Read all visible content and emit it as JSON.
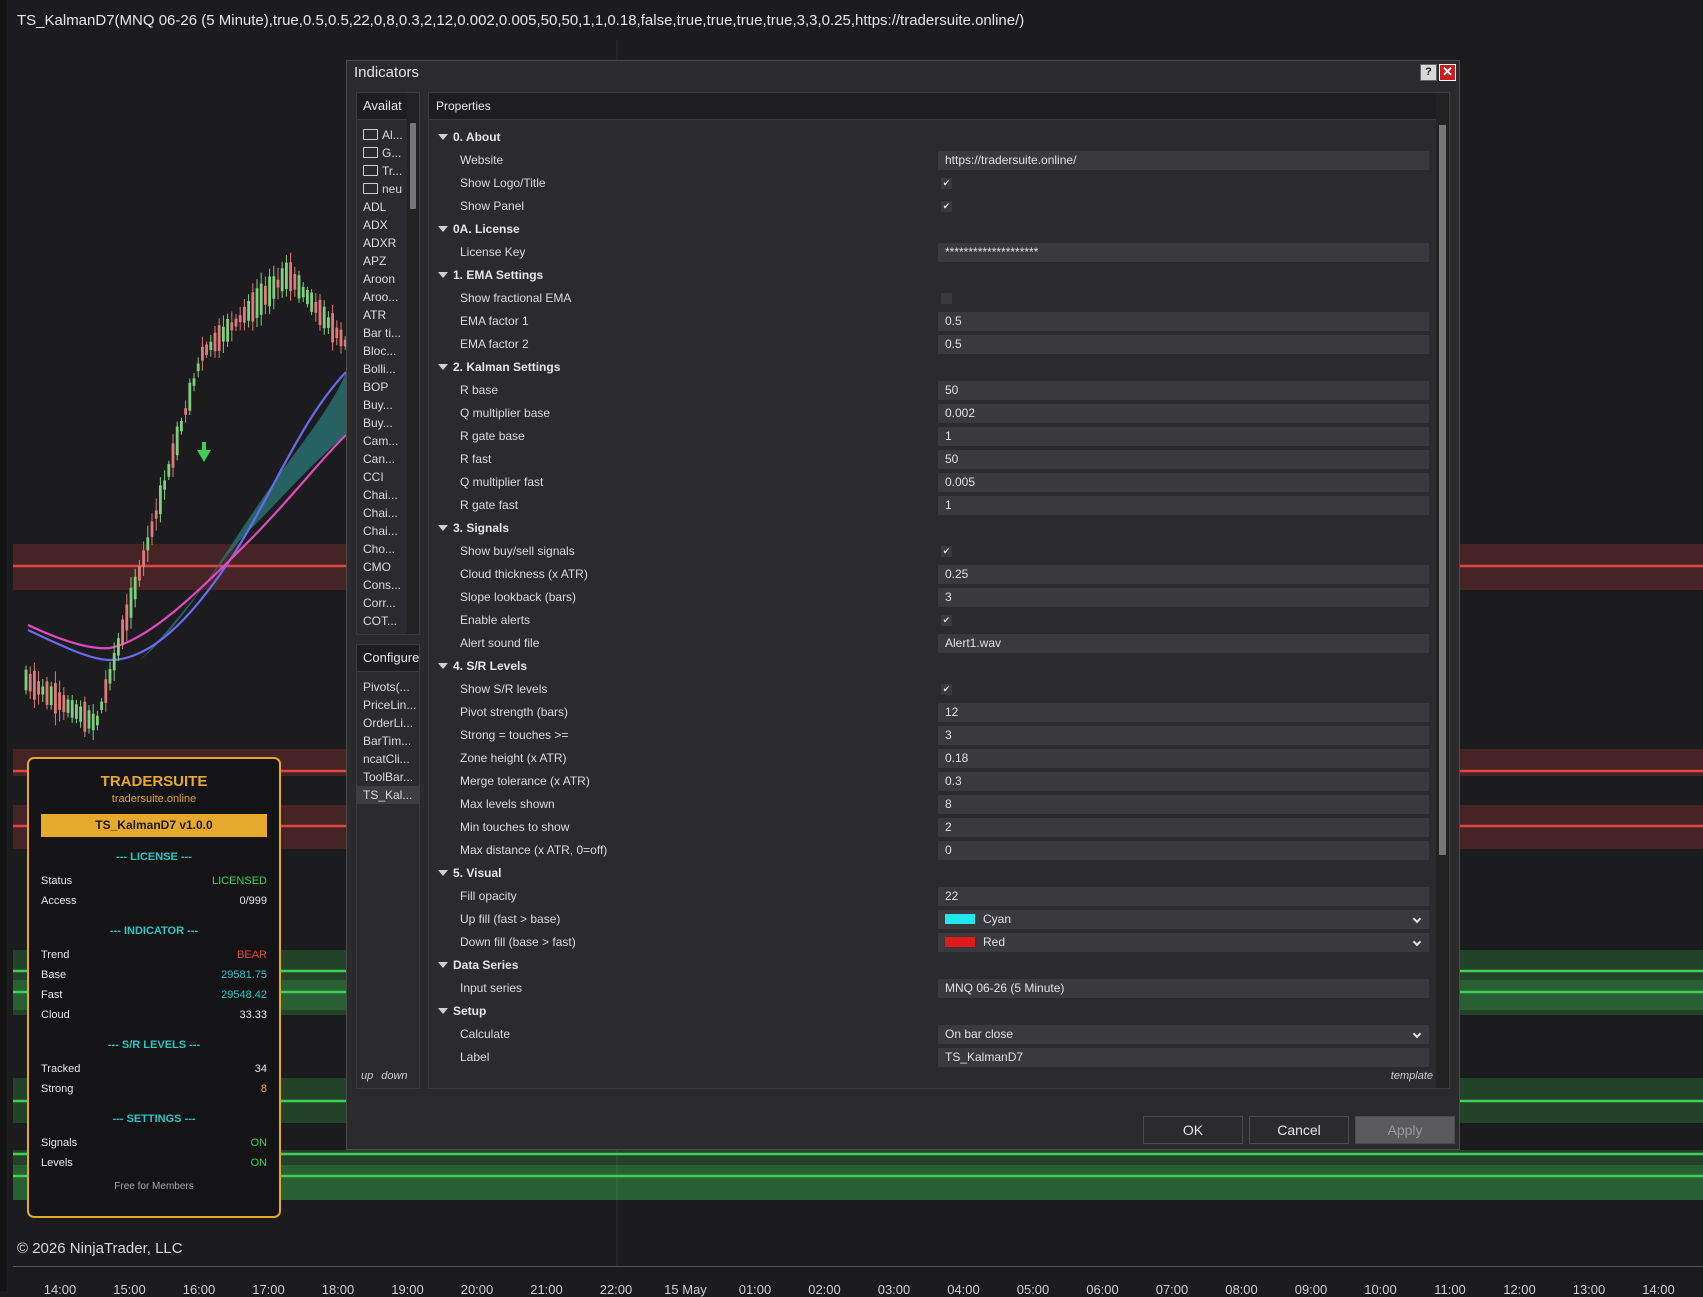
{
  "chart": {
    "title": "TS_KalmanD7(MNQ 06-26 (5 Minute),true,0.5,0.5,22,0,8,0.3,2,12,0.002,0.005,50,50,1,1,0.18,false,true,true,true,true,3,3,0.25,https://tradersuite.online/)",
    "copyright": "© 2026 NinjaTrader, LLC",
    "time_ticks": [
      "14:00",
      "15:00",
      "16:00",
      "17:00",
      "18:00",
      "19:00",
      "20:00",
      "21:00",
      "22:00",
      "15 May",
      "01:00",
      "02:00",
      "03:00",
      "04:00",
      "05:00",
      "06:00",
      "07:00",
      "08:00",
      "09:00",
      "10:00",
      "11:00",
      "12:00",
      "13:00",
      "14:00"
    ],
    "colors": {
      "fast_line": "#e04ac0",
      "base_line": "#6a6af0",
      "cloud_up": "#2a7a7a",
      "resistance": "#e04545",
      "support": "#3ecf55",
      "candle_up": "#7fcf7f",
      "candle_down": "#e07a7a",
      "buy_signal": "#3ecf55"
    }
  },
  "ts_panel": {
    "brand": "TRADERSUITE",
    "site": "tradersuite.online",
    "version": "TS_KalmanD7 v1.0.0",
    "license_title": "--- LICENSE ---",
    "license": [
      {
        "label": "Status",
        "value": "LICENSED",
        "color": "#3ecf55"
      },
      {
        "label": "Access",
        "value": "0/999",
        "color": "#e8e8e8"
      }
    ],
    "indicator_title": "--- INDICATOR ---",
    "indicator": [
      {
        "label": "Trend",
        "value": "BEAR",
        "color": "#e04545"
      },
      {
        "label": "Base",
        "value": "29581.75",
        "color": "#2ec4c4"
      },
      {
        "label": "Fast",
        "value": "29548.42",
        "color": "#2ec4c4"
      },
      {
        "label": "Cloud",
        "value": "33.33",
        "color": "#e8e8e8"
      }
    ],
    "sr_title": "--- S/R LEVELS ---",
    "sr": [
      {
        "label": "Tracked",
        "value": "34",
        "color": "#e8e8e8"
      },
      {
        "label": "Strong",
        "value": "8",
        "color": "#e6a92e"
      }
    ],
    "settings_title": "--- SETTINGS ---",
    "settings": [
      {
        "label": "Signals",
        "value": "ON",
        "color": "#3ecf55"
      },
      {
        "label": "Levels",
        "value": "ON",
        "color": "#3ecf55"
      }
    ],
    "footer": "Free for Members"
  },
  "dialog": {
    "title": "Indicators",
    "help": "?",
    "close": "✕",
    "available_header": "Availat",
    "available_items": [
      {
        "label": "Al...",
        "folder": true
      },
      {
        "label": "G...",
        "folder": true
      },
      {
        "label": "Tr...",
        "folder": true
      },
      {
        "label": "neu",
        "folder": true
      },
      {
        "label": "ADL"
      },
      {
        "label": "ADX"
      },
      {
        "label": "ADXR"
      },
      {
        "label": "APZ"
      },
      {
        "label": "Aroon"
      },
      {
        "label": "Aroo..."
      },
      {
        "label": "ATR"
      },
      {
        "label": "Bar ti..."
      },
      {
        "label": "Bloc..."
      },
      {
        "label": "Bolli..."
      },
      {
        "label": "BOP"
      },
      {
        "label": "Buy..."
      },
      {
        "label": "Buy..."
      },
      {
        "label": "Cam..."
      },
      {
        "label": "Can..."
      },
      {
        "label": "CCI"
      },
      {
        "label": "Chai..."
      },
      {
        "label": "Chai..."
      },
      {
        "label": "Chai..."
      },
      {
        "label": "Cho..."
      },
      {
        "label": "CMO"
      },
      {
        "label": "Cons..."
      },
      {
        "label": "Corr..."
      },
      {
        "label": "COT..."
      }
    ],
    "configured_header": "Configure",
    "configured_items": [
      "Pivots(...",
      "PriceLin...",
      "OrderLi...",
      "BarTim...",
      "ncatCli...",
      "ToolBar...",
      "TS_Kal..."
    ],
    "up_label": "up",
    "down_label": "down",
    "properties_header": "Properties",
    "template_label": "template",
    "properties": [
      {
        "type": "cat",
        "label": "0. About"
      },
      {
        "type": "text",
        "label": "Website",
        "value": "https://tradersuite.online/"
      },
      {
        "type": "check",
        "label": "Show Logo/Title",
        "checked": true
      },
      {
        "type": "check",
        "label": "Show Panel",
        "checked": true
      },
      {
        "type": "cat",
        "label": "0A. License"
      },
      {
        "type": "text",
        "label": "License Key",
        "value": "********************"
      },
      {
        "type": "cat",
        "label": "1. EMA Settings"
      },
      {
        "type": "check",
        "label": "Show fractional EMA",
        "checked": false
      },
      {
        "type": "text",
        "label": "EMA factor 1",
        "value": "0.5"
      },
      {
        "type": "text",
        "label": "EMA factor 2",
        "value": "0.5"
      },
      {
        "type": "cat",
        "label": "2. Kalman Settings"
      },
      {
        "type": "text",
        "label": "R base",
        "value": "50"
      },
      {
        "type": "text",
        "label": "Q multiplier base",
        "value": "0.002"
      },
      {
        "type": "text",
        "label": "R gate base",
        "value": "1"
      },
      {
        "type": "text",
        "label": "R fast",
        "value": "50"
      },
      {
        "type": "text",
        "label": "Q multiplier fast",
        "value": "0.005"
      },
      {
        "type": "text",
        "label": "R gate fast",
        "value": "1"
      },
      {
        "type": "cat",
        "label": "3. Signals"
      },
      {
        "type": "check",
        "label": "Show buy/sell signals",
        "checked": true
      },
      {
        "type": "text",
        "label": "Cloud thickness (x ATR)",
        "value": "0.25"
      },
      {
        "type": "text",
        "label": "Slope lookback (bars)",
        "value": "3"
      },
      {
        "type": "check",
        "label": "Enable alerts",
        "checked": true
      },
      {
        "type": "text",
        "label": "Alert sound file",
        "value": "Alert1.wav"
      },
      {
        "type": "cat",
        "label": "4. S/R Levels"
      },
      {
        "type": "check",
        "label": "Show S/R levels",
        "checked": true
      },
      {
        "type": "text",
        "label": "Pivot strength (bars)",
        "value": "12"
      },
      {
        "type": "text",
        "label": "Strong = touches >=",
        "value": "3"
      },
      {
        "type": "text",
        "label": "Zone height (x ATR)",
        "value": "0.18"
      },
      {
        "type": "text",
        "label": "Merge tolerance (x ATR)",
        "value": "0.3"
      },
      {
        "type": "text",
        "label": "Max levels shown",
        "value": "8"
      },
      {
        "type": "text",
        "label": "Min touches to show",
        "value": "2"
      },
      {
        "type": "text",
        "label": "Max distance (x ATR, 0=off)",
        "value": "0"
      },
      {
        "type": "cat",
        "label": "5. Visual"
      },
      {
        "type": "text",
        "label": "Fill opacity",
        "value": "22"
      },
      {
        "type": "color",
        "label": "Up fill (fast > base)",
        "value": "Cyan",
        "swatch": "#22e6f0"
      },
      {
        "type": "color",
        "label": "Down fill (base > fast)",
        "value": "Red",
        "swatch": "#e01919"
      },
      {
        "type": "cat",
        "label": "Data Series"
      },
      {
        "type": "text",
        "label": "Input series",
        "value": "MNQ 06-26 (5 Minute)"
      },
      {
        "type": "cat",
        "label": "Setup"
      },
      {
        "type": "select",
        "label": "Calculate",
        "value": "On bar close"
      },
      {
        "type": "text",
        "label": "Label",
        "value": "TS_KalmanD7"
      }
    ],
    "ok_label": "OK",
    "cancel_label": "Cancel",
    "apply_label": "Apply"
  }
}
